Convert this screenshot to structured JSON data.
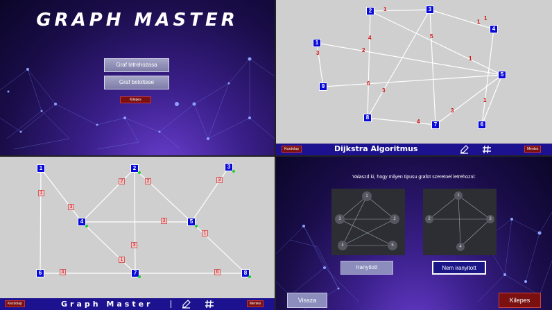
{
  "menu": {
    "title": "GRAPH MASTER",
    "create_label": "Graf letrehozasa",
    "load_label": "Graf betoltese",
    "exit_label": "Kilepes"
  },
  "dijkstra": {
    "home_label": "Kezdolap",
    "title": "Dijkstra Algoritmus",
    "save_label": "Mentes",
    "nodes": [
      "1",
      "2",
      "3",
      "4",
      "5",
      "6",
      "7",
      "8",
      "9"
    ],
    "weights": [
      "1",
      "1",
      "4",
      "5",
      "1",
      "2",
      "3",
      "1",
      "1",
      "6",
      "3",
      "3",
      "4"
    ]
  },
  "editor": {
    "home_label": "Kezdolap",
    "title": "Graph Master",
    "save_label": "Mentes",
    "nodes": [
      "1",
      "2",
      "3",
      "4",
      "5",
      "6",
      "7",
      "8"
    ],
    "weights": [
      "1",
      "3",
      "2",
      "2",
      "3",
      "3",
      "3",
      "1",
      "1",
      "1",
      "4",
      "6"
    ]
  },
  "create": {
    "prompt": "Valaszd ki, hogy milyen tipusu grafot szeretnel letrehozni:",
    "directed_label": "Iranyitott",
    "undirected_label": "Nem iranyitott",
    "back_label": "Vissza",
    "exit_label": "Kilepes",
    "directed_nodes": [
      "1",
      "2",
      "3",
      "4",
      "5"
    ],
    "undirected_nodes": [
      "1",
      "2",
      "3",
      "4"
    ]
  },
  "icons": [
    "edit-icon",
    "hash-icon"
  ],
  "colors": {
    "accent": "#1c1290",
    "node": "#0a0ad8",
    "danger": "#7a1010",
    "weight": "#d81010"
  }
}
